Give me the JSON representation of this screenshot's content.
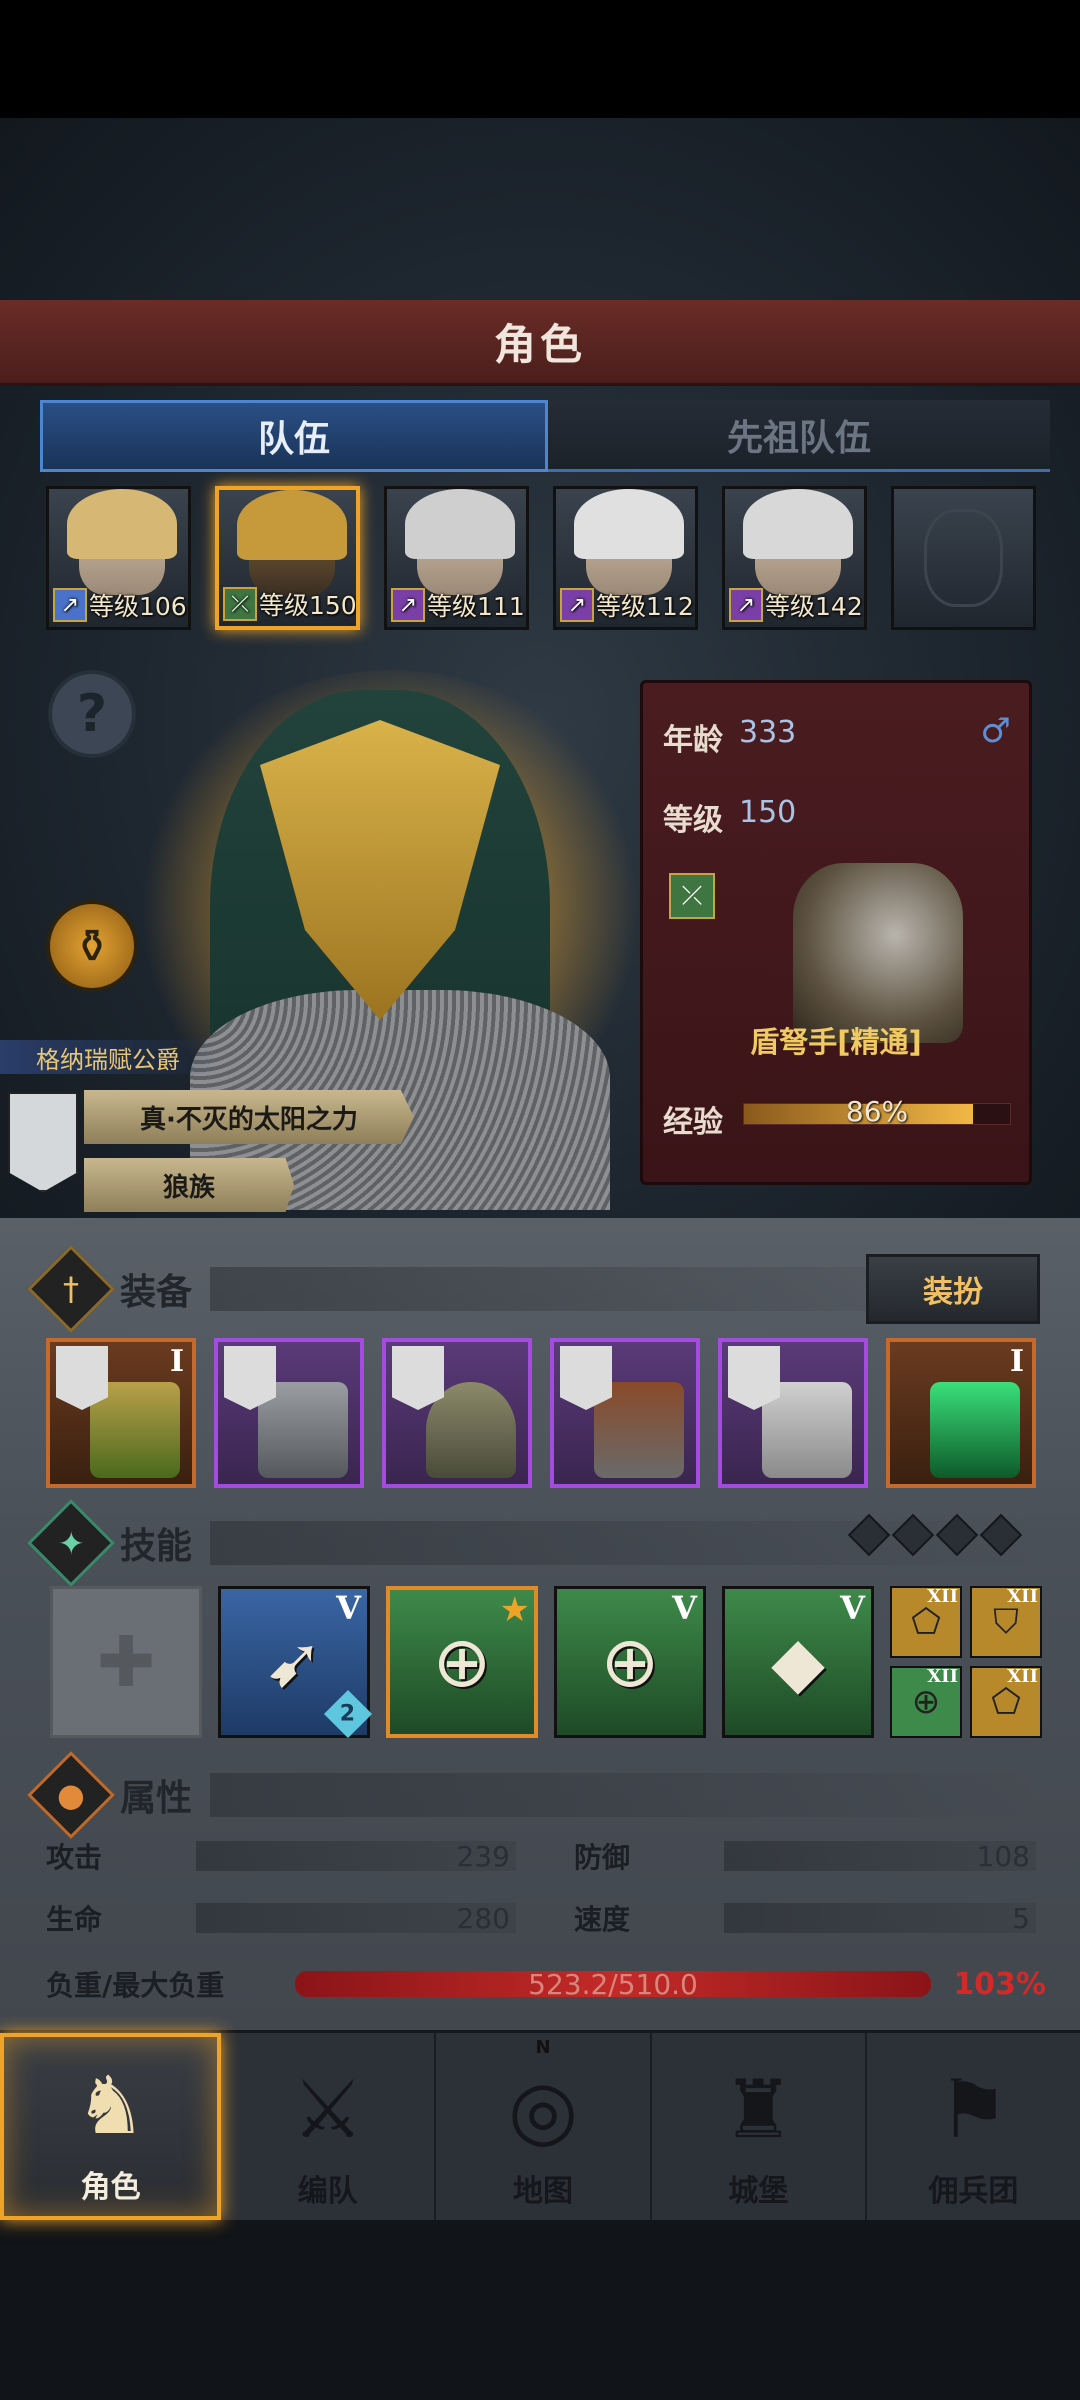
{
  "header": {
    "title": "角色"
  },
  "tabs": [
    {
      "label": "队伍"
    },
    {
      "label": "先祖队伍"
    }
  ],
  "team": [
    {
      "level": "等级106",
      "hair": "#d6b774",
      "cls": "↗"
    },
    {
      "level": "等级150",
      "hair": "#c69a3a",
      "cls": "⤫"
    },
    {
      "level": "等级111",
      "hair": "#cfcfcf",
      "cls": "↗"
    },
    {
      "level": "等级112",
      "hair": "#e0e0e0",
      "cls": "↗"
    },
    {
      "level": "等级142",
      "hair": "#d8d8d8",
      "cls": "↗"
    }
  ],
  "hero": {
    "title_tag": "格纳瑞赋公爵",
    "trait1": "真·不灭的太阳之力",
    "trait2": "狼族"
  },
  "info": {
    "age_label": "年龄",
    "age_value": "333",
    "level_label": "等级",
    "level_value": "150",
    "class_name": "盾弩手[精通]",
    "exp_label": "经验",
    "exp_percent": "86%",
    "exp_fraction": 0.86,
    "gender_icon": "male-icon"
  },
  "equipment": {
    "title": "装备",
    "dress_button": "装扮",
    "slots": [
      {
        "rank": "I",
        "rarity": "orange"
      },
      {
        "rank": "",
        "rarity": "purple"
      },
      {
        "rank": "",
        "rarity": "purple"
      },
      {
        "rank": "",
        "rarity": "purple"
      },
      {
        "rank": "",
        "rarity": "purple"
      },
      {
        "rank": "I",
        "rarity": "orange"
      }
    ]
  },
  "skills": {
    "title": "技能",
    "main": [
      {
        "kind": "empty",
        "glyph": "✚",
        "numeral": ""
      },
      {
        "kind": "blue",
        "glyph": "➹",
        "numeral": "V",
        "badge": "2"
      },
      {
        "kind": "green-o",
        "glyph": "⊕",
        "numeral": "",
        "star": "★"
      },
      {
        "kind": "green",
        "glyph": "⊕",
        "numeral": "V"
      },
      {
        "kind": "green",
        "glyph": "◆",
        "numeral": "V"
      }
    ],
    "passive": [
      {
        "numeral": "XII",
        "glyph": "⬠",
        "color": "gold"
      },
      {
        "numeral": "XII",
        "glyph": "⛉",
        "color": "gold"
      },
      {
        "numeral": "XII",
        "glyph": "⊕",
        "color": "green"
      },
      {
        "numeral": "XII",
        "glyph": "⬠",
        "color": "gold"
      }
    ]
  },
  "attributes": {
    "title": "属性",
    "attack_label": "攻击",
    "attack_value": "239",
    "defense_label": "防御",
    "defense_value": "108",
    "hp_label": "生命",
    "hp_value": "280",
    "speed_label": "速度",
    "speed_value": "5",
    "weight_label": "负重/最大负重",
    "weight_value": "523.2/510.0",
    "weight_percent": "103%"
  },
  "nav": [
    {
      "label": "角色",
      "glyph": "♞"
    },
    {
      "label": "编队",
      "glyph": "⚔"
    },
    {
      "label": "地图",
      "glyph": "◎",
      "compass": "N"
    },
    {
      "label": "城堡",
      "glyph": "♜"
    },
    {
      "label": "佣兵团",
      "glyph": "⚑"
    }
  ],
  "colors": {
    "accent_gold": "#f0a427",
    "tab_blue": "#2a4f86",
    "banner_red": "#6b2c26",
    "overweight_red": "#d02a2a"
  }
}
